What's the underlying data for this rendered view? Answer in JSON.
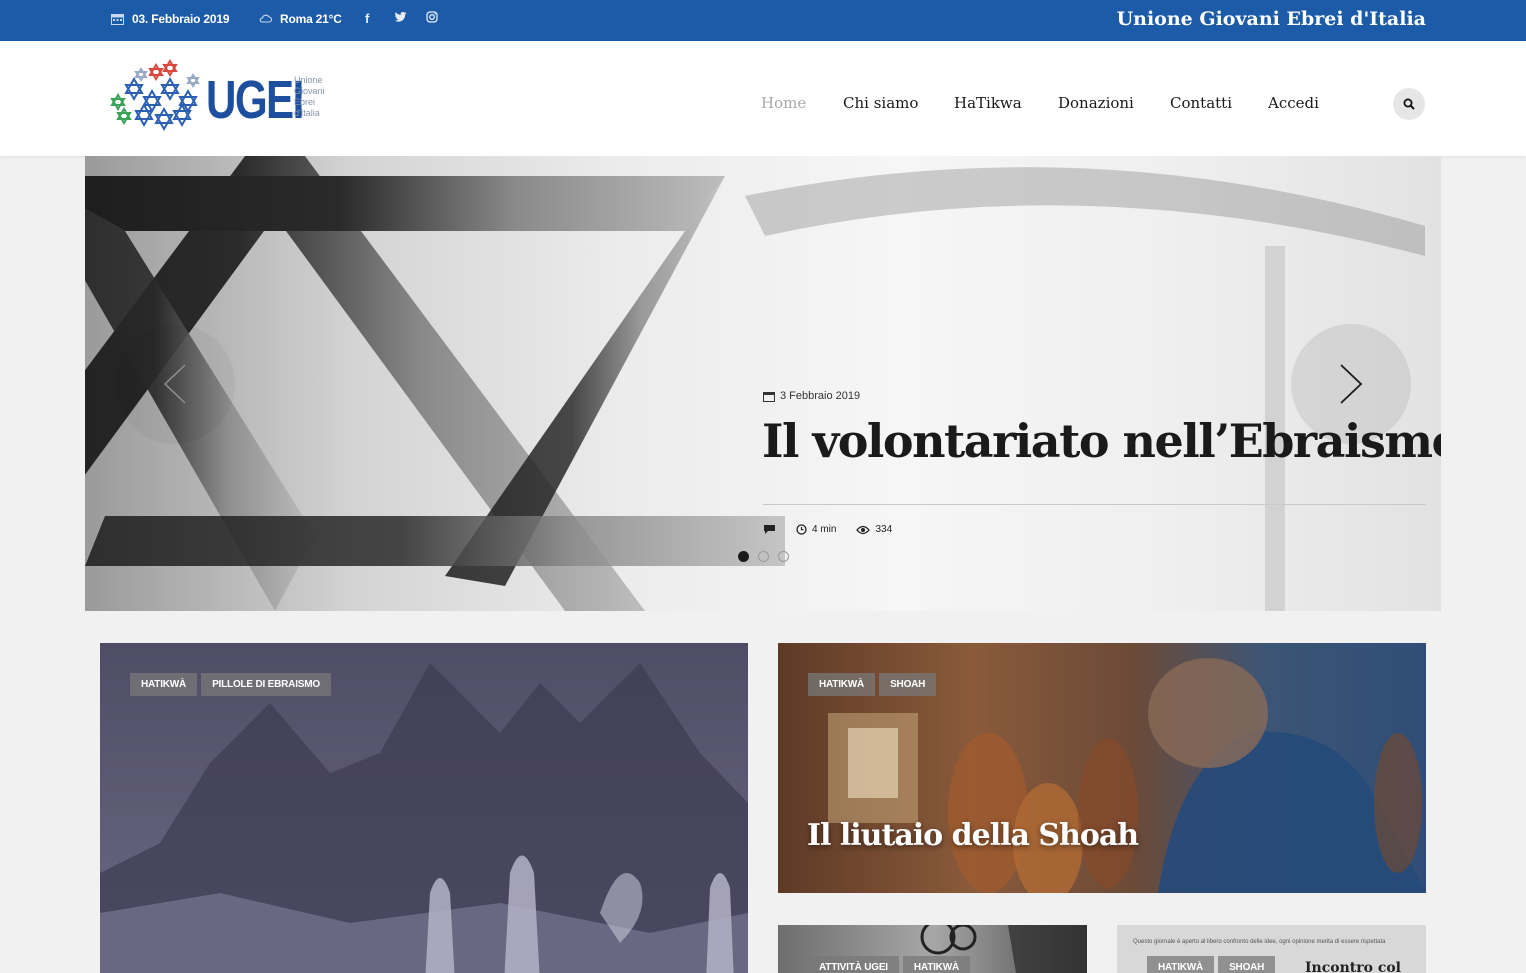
{
  "topbar": {
    "date": "03. Febbraio 2019",
    "weather": "Roma 21°C",
    "site_name": "Unione Giovani Ebrei d'Italia",
    "social": [
      "facebook-icon",
      "twitter-icon",
      "instagram-icon"
    ]
  },
  "logo": {
    "word": "UGEI",
    "sub": [
      "Unione",
      "Giovani",
      "Ebrei",
      "d'Italia"
    ]
  },
  "nav": {
    "items": [
      {
        "label": "Home",
        "active": true
      },
      {
        "label": "Chi siamo",
        "active": false
      },
      {
        "label": "HaTikwa",
        "active": false
      },
      {
        "label": "Donazioni",
        "active": false
      },
      {
        "label": "Contatti",
        "active": false
      },
      {
        "label": "Accedi",
        "active": false
      }
    ]
  },
  "hero": {
    "date": "3 Febbraio 2019",
    "title": "Il volontariato nell’Ebraismo",
    "read_time": "4 min",
    "views": "334",
    "slides": 3,
    "active_slide": 0
  },
  "cards": {
    "big": {
      "tags": [
        "HATIKWÀ",
        "PILLOLE DI EBRAISMO"
      ]
    },
    "med": {
      "tags": [
        "HATIKWÀ",
        "SHOAH"
      ],
      "title": "Il liutaio della Shoah"
    },
    "sm1": {
      "tags": [
        "ATTIVITÀ UGEI",
        "HATIKWÀ"
      ]
    },
    "sm2": {
      "tags": [
        "HATIKWÀ",
        "SHOAH"
      ],
      "headline": "Incontro col",
      "newsprint": "Questo giornale è aperto al libero confronto delle idee, ogni opinione merita di essere rispettata"
    }
  },
  "colors": {
    "topbar": "#1c5ba8",
    "logo_blue": "#1e4f9e",
    "nav_active": "#a9a9a9"
  }
}
